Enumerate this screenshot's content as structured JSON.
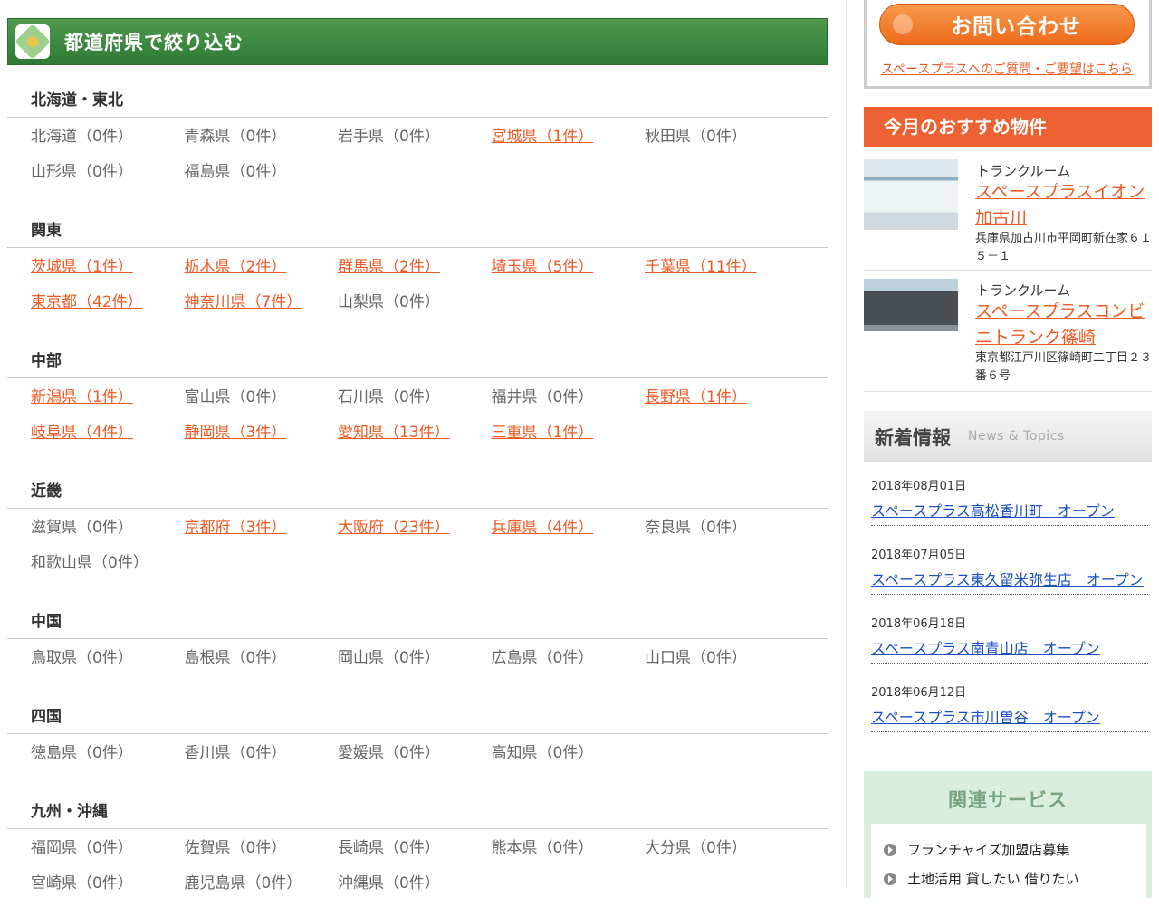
{
  "header": {
    "title": "都道府県で絞り込む",
    "icon": "crossed-tools-icon",
    "bg": "#3a8a3e"
  },
  "regions": [
    {
      "name": "北海道・東北",
      "prefs": [
        {
          "label": "北海道（0件）",
          "active": false
        },
        {
          "label": "青森県（0件）",
          "active": false
        },
        {
          "label": "岩手県（0件）",
          "active": false
        },
        {
          "label": "宮城県（1件）",
          "active": true
        },
        {
          "label": "秋田県（0件）",
          "active": false
        },
        {
          "label": "山形県（0件）",
          "active": false
        },
        {
          "label": "福島県（0件）",
          "active": false
        }
      ]
    },
    {
      "name": "関東",
      "prefs": [
        {
          "label": "茨城県（1件）",
          "active": true
        },
        {
          "label": "栃木県（2件）",
          "active": true
        },
        {
          "label": "群馬県（2件）",
          "active": true
        },
        {
          "label": "埼玉県（5件）",
          "active": true
        },
        {
          "label": "千葉県（11件）",
          "active": true
        },
        {
          "label": "東京都（42件）",
          "active": true
        },
        {
          "label": "神奈川県（7件）",
          "active": true
        },
        {
          "label": "山梨県（0件）",
          "active": false
        }
      ]
    },
    {
      "name": "中部",
      "prefs": [
        {
          "label": "新潟県（1件）",
          "active": true
        },
        {
          "label": "富山県（0件）",
          "active": false
        },
        {
          "label": "石川県（0件）",
          "active": false
        },
        {
          "label": "福井県（0件）",
          "active": false
        },
        {
          "label": "長野県（1件）",
          "active": true
        },
        {
          "label": "岐阜県（4件）",
          "active": true
        },
        {
          "label": "静岡県（3件）",
          "active": true
        },
        {
          "label": "愛知県（13件）",
          "active": true
        },
        {
          "label": "三重県（1件）",
          "active": true
        }
      ]
    },
    {
      "name": "近畿",
      "prefs": [
        {
          "label": "滋賀県（0件）",
          "active": false
        },
        {
          "label": "京都府（3件）",
          "active": true
        },
        {
          "label": "大阪府（23件）",
          "active": true
        },
        {
          "label": "兵庫県（4件）",
          "active": true
        },
        {
          "label": "奈良県（0件）",
          "active": false
        },
        {
          "label": "和歌山県（0件）",
          "active": false
        }
      ]
    },
    {
      "name": "中国",
      "prefs": [
        {
          "label": "鳥取県（0件）",
          "active": false
        },
        {
          "label": "島根県（0件）",
          "active": false
        },
        {
          "label": "岡山県（0件）",
          "active": false
        },
        {
          "label": "広島県（0件）",
          "active": false
        },
        {
          "label": "山口県（0件）",
          "active": false
        }
      ]
    },
    {
      "name": "四国",
      "prefs": [
        {
          "label": "徳島県（0件）",
          "active": false
        },
        {
          "label": "香川県（0件）",
          "active": false
        },
        {
          "label": "愛媛県（0件）",
          "active": false
        },
        {
          "label": "高知県（0件）",
          "active": false
        }
      ]
    },
    {
      "name": "九州・沖縄",
      "prefs": [
        {
          "label": "福岡県（0件）",
          "active": false
        },
        {
          "label": "佐賀県（0件）",
          "active": false
        },
        {
          "label": "長崎県（0件）",
          "active": false
        },
        {
          "label": "熊本県（0件）",
          "active": false
        },
        {
          "label": "大分県（0件）",
          "active": false
        },
        {
          "label": "宮崎県（0件）",
          "active": false
        },
        {
          "label": "鹿児島県（0件）",
          "active": false
        },
        {
          "label": "沖縄県（0件）",
          "active": false
        }
      ]
    }
  ],
  "sidebar": {
    "contact": {
      "button": "お問い合わせ",
      "link": "スペースプラスへのご質問・ご要望はこちら"
    },
    "recommend": {
      "title": "今月のおすすめ物件",
      "items": [
        {
          "category": "トランクルーム",
          "name": "スペースプラスイオン加古川",
          "address": "兵庫県加古川市平岡町新在家６１５－１"
        },
        {
          "category": "トランクルーム",
          "name": "スペースプラスコンビニトランク篠崎",
          "address": "東京都江戸川区篠崎町二丁目２３番６号"
        }
      ]
    },
    "news": {
      "title": "新着情報",
      "subtitle": "News & Topics",
      "items": [
        {
          "date": "2018年08月01日",
          "text": "スペースプラス高松香川町　オープン"
        },
        {
          "date": "2018年07月05日",
          "text": "スペースプラス東久留米弥生店　オープン"
        },
        {
          "date": "2018年06月18日",
          "text": "スペースプラス南青山店　オープン"
        },
        {
          "date": "2018年06月12日",
          "text": "スペースプラス市川曽谷　オープン"
        }
      ]
    },
    "related": {
      "title": "関連サービス",
      "items": [
        "フランチャイズ加盟店募集",
        "土地活用 貸したい 借りたい"
      ]
    }
  },
  "colors": {
    "accent": "#ef5a24",
    "link": "#1a4fbf",
    "header_green": "#3a8a3e"
  }
}
